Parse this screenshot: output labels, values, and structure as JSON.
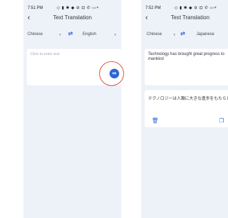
{
  "left": {
    "status_time": "7:51 PM",
    "status_icons": "◇ ▮ ✱ ◆ ⊘ ⊡ ✆ ▭+",
    "back_icon": "‹",
    "title": "Text Translation",
    "source_lang": "Chinese",
    "target_lang": "English",
    "placeholder": "Click to enter text",
    "translate_icon": "⇛"
  },
  "right": {
    "status_time": "7:52 PM",
    "status_icons": "◇ ▮ ✱ ◆ ⊘ ⊡ ✆ ▭+",
    "back_icon": "‹",
    "title": "Text Translation",
    "source_lang": "Chinese",
    "target_lang": "Japanese",
    "source_text": "Technology has brought great progress to mankind",
    "result_text": "テクノロジーは人類に大きな進歩をもたらし",
    "delete_icon": "🗑",
    "copy_icon": "❐"
  },
  "common": {
    "dropdown_icon": "▾",
    "swap_icon": "⇄"
  },
  "colors": {
    "accent": "#2f66d6",
    "highlight": "#e74c3c",
    "panel_bg": "#edf1f8"
  }
}
